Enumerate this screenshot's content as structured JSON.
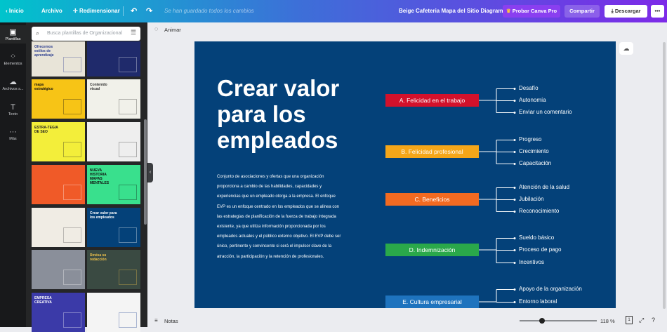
{
  "topbar": {
    "home": "Inicio",
    "file": "Archivo",
    "resize": "Redimensionar",
    "save_status": "Se han guardado todos los cambios",
    "doc_title": "Beige Cafeteria Mapa del Sitio Diagrama",
    "pro": "Probar Canva Pro",
    "share": "Compartir",
    "download": "Descargar"
  },
  "rail": [
    {
      "label": "Plantillas",
      "icon": "templates-icon"
    },
    {
      "label": "Elementos",
      "icon": "elements-icon"
    },
    {
      "label": "Archivos s...",
      "icon": "uploads-icon"
    },
    {
      "label": "Texto",
      "icon": "text-icon"
    },
    {
      "label": "Más",
      "icon": "more-icon"
    }
  ],
  "panel": {
    "search_placeholder": "Busca plantillas de Organizacional",
    "thumbs": [
      {
        "title": "Ofrecemos estilos de aprendizaje",
        "bg": "#e8e4d8",
        "fg": "#2b3d8f"
      },
      {
        "title": "",
        "bg": "#1f2a6b",
        "fg": "#ffffff"
      },
      {
        "title": "mapa estratégico",
        "bg": "#f7c416",
        "fg": "#111111"
      },
      {
        "title": "Contenido visual",
        "bg": "#f1f1ea",
        "fg": "#333333"
      },
      {
        "title": "ESTRA-TEGIA DE SEO",
        "bg": "#f3ee3a",
        "fg": "#222222"
      },
      {
        "title": "",
        "bg": "#eeeeee",
        "fg": "#333333"
      },
      {
        "title": "",
        "bg": "#f05a28",
        "fg": "#ffffff"
      },
      {
        "title": "NUEVA HISTORIA MAPAS MENTALES",
        "bg": "#39e08d",
        "fg": "#111111"
      },
      {
        "title": "",
        "bg": "#f0ece4",
        "fg": "#555555"
      },
      {
        "title": "Crear valor para los empleados",
        "bg": "#044179",
        "fg": "#ffffff"
      },
      {
        "title": "",
        "bg": "#8a8f9a",
        "fg": "#ffffff"
      },
      {
        "title": "Revisa su redacción",
        "bg": "#3a4a42",
        "fg": "#f2c44b"
      },
      {
        "title": "EMPRESA CREATIVA",
        "bg": "#3b3aa8",
        "fg": "#ffffff"
      },
      {
        "title": "",
        "bg": "#f4f4f4",
        "fg": "#1e3e8f"
      }
    ]
  },
  "toolbar": {
    "animate": "Animar"
  },
  "slide": {
    "title": "Crear valor para los empleados",
    "paragraph": "Conjunto de asociaciones y ofertas que una organización proporciona a cambio de las habilidades, capacidades y experiencias que un empleado otorga a la empresa. El enfoque EVP es un enfoque centrado en los empleados que se alinea con las estrategias de planificación de la fuerza de trabajo integrada existente, ya que utiliza información proporcionada por los empleados actuales y el público externo objetivo. El EVP debe ser único, pertinente y convincente si será el impulsor clave de la atracción, la participación y la retención de profesionales.",
    "categories": [
      {
        "label": "A. Felicidad en el trabajo",
        "color": "#d3112b",
        "items": [
          "Desafío",
          "Autonomía",
          "Enviar un comentario"
        ]
      },
      {
        "label": "B. Felicidad profesional",
        "color": "#f5a619",
        "items": [
          "Progreso",
          "Crecimiento",
          "Capacitación"
        ]
      },
      {
        "label": "C. Beneficios",
        "color": "#f26a21",
        "items": [
          "Atención de la salud",
          "Jubilación",
          "Reconocimiento"
        ]
      },
      {
        "label": "D. Indemnización",
        "color": "#2aa84a",
        "items": [
          "Sueldo básico",
          "Proceso de pago",
          "Incentivos"
        ]
      },
      {
        "label": "E. Cultura empresarial",
        "color": "#1e73be",
        "items": [
          "Apoyo de la organización",
          "Entorno laboral"
        ]
      }
    ]
  },
  "bottombar": {
    "notes": "Notas",
    "zoom": "118 %",
    "page": "1"
  }
}
